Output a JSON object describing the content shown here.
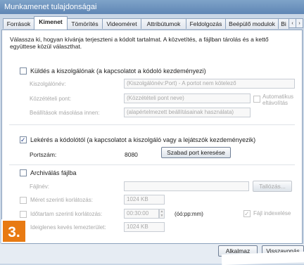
{
  "window": {
    "title": "Munkamenet tulajdonságai"
  },
  "tabs": [
    "Források",
    "Kimenet",
    "Tömörítés",
    "Videoméret",
    "Attribútumok",
    "Feldolgozás",
    "Beépülő modulok",
    "Bi"
  ],
  "tab_active_index": 1,
  "tab_scroll": {
    "left": "‹",
    "right": "›"
  },
  "intro": {
    "line1": "Válassza ki, hogyan kívánja terjeszteni a kódolt tartalmat. A közvetítés, a fájlban tárolás és a kettő",
    "line2": "együttese közül választhat."
  },
  "send": {
    "checkbox_label": "Küldés a kiszolgálónak (a kapcsolatot a kódoló kezdeményezi)",
    "checked": false,
    "server_label": "Kiszolgálónév:",
    "server_value": "(Kiszolgálónév:Port) - A portot nem kötelező",
    "pubpoint_label": "Közzétételi pont:",
    "pubpoint_value": "(Közzétételi pont neve)",
    "copy_label": "Beállítások másolása innen:",
    "copy_value": "(alapértelmezett beállításainak használata)",
    "auto_remove_line1": "Automatikus",
    "auto_remove_line2": "eltávolítás"
  },
  "pull": {
    "checkbox_label": "Lekérés a kódolótól (a kapcsolatot a kiszolgáló vagy a lejátszók kezdeményezik)",
    "checked": true,
    "check_glyph": "✓",
    "port_label": "Portszám:",
    "port_value": "8080",
    "find_port_button": "Szabad port keresése"
  },
  "archive": {
    "checkbox_label": "Archiválás fájlba",
    "checked": false,
    "file_label": "Fájlnév:",
    "browse_button": "Tallózás...",
    "size_limit_label": "Méret szerinti korlátozás:",
    "size_limit_value": "1024 KB",
    "time_limit_label": "Időtartam szerinti korlátozás:",
    "time_limit_value": "00:30:00",
    "time_format": "(óó:pp:mm)",
    "index_label": "Fájl indexelése",
    "index_checked": true,
    "check_glyph": "✓",
    "temp_label": "Ideiglenes kevés lemezterület:",
    "temp_value": "1024 KB"
  },
  "footer": {
    "apply_button": "Alkalmaz",
    "revert_button": "Visszavonás"
  },
  "badge": "3."
}
